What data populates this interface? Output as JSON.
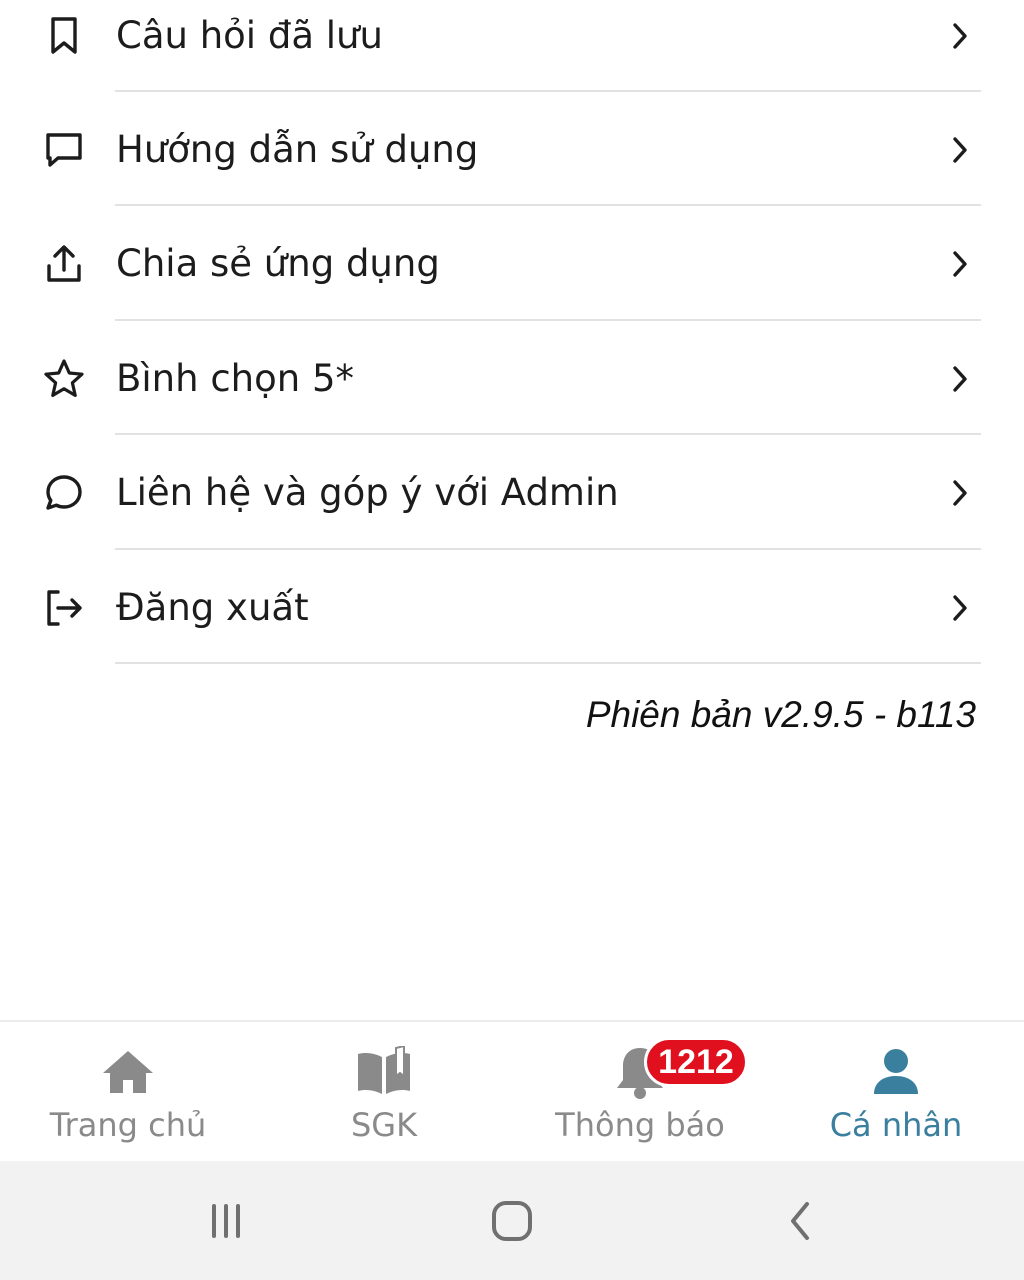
{
  "menu": {
    "items": [
      {
        "label": "Câu hỏi đã lưu",
        "icon": "bookmark-icon"
      },
      {
        "label": "Hướng dẫn sử dụng",
        "icon": "chat-square-icon"
      },
      {
        "label": "Chia sẻ ứng dụng",
        "icon": "share-upload-icon"
      },
      {
        "label": "Bình chọn 5*",
        "icon": "star-icon"
      },
      {
        "label": "Liên hệ và góp ý với Admin",
        "icon": "chat-round-icon"
      },
      {
        "label": "Đăng xuất",
        "icon": "logout-icon"
      }
    ],
    "chevron_icon": "chevron-right-icon"
  },
  "version_text": "Phiên bản v2.9.5 - b113",
  "bottom_nav": {
    "items": [
      {
        "label": "Trang chủ",
        "icon": "home-icon",
        "active": false
      },
      {
        "label": "SGK",
        "icon": "book-icon",
        "active": false
      },
      {
        "label": "Thông báo",
        "icon": "bell-icon",
        "active": false
      },
      {
        "label": "Cá nhân",
        "icon": "user-icon",
        "active": true
      }
    ],
    "notification_badge": "1212"
  },
  "colors": {
    "active": "#3b7f9f",
    "inactive": "#8a8a8a",
    "badge": "#e0101e",
    "text": "#1c1c1c"
  },
  "system_bar": {
    "buttons": [
      "recent-apps-icon",
      "home-circle-icon",
      "back-icon"
    ]
  }
}
